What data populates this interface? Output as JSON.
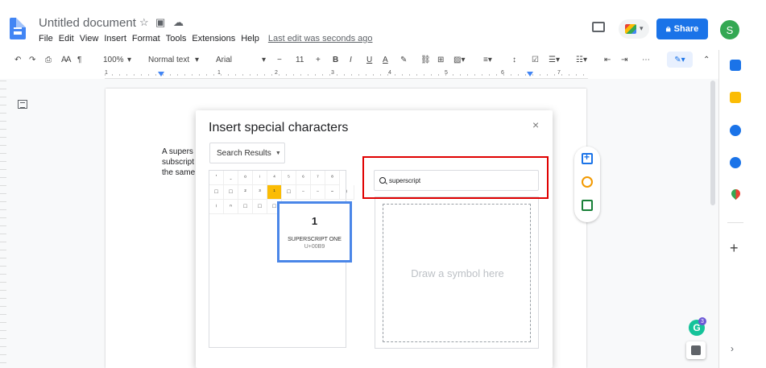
{
  "doc": {
    "title": "Untitled document",
    "last_edit": "Last edit was seconds ago"
  },
  "menu": [
    "File",
    "Edit",
    "View",
    "Insert",
    "Format",
    "Tools",
    "Extensions",
    "Help"
  ],
  "header": {
    "share_label": "Share",
    "avatar_letter": "S"
  },
  "toolbar": {
    "zoom": "100%",
    "style": "Normal text",
    "font": "Arial",
    "font_size": "11",
    "minus": "−",
    "plus": "+",
    "bold": "B",
    "italic": "I",
    "underline": "U",
    "text_color": "A"
  },
  "ruler": {
    "numbers": [
      "1",
      "1",
      "2",
      "3",
      "4",
      "5",
      "6",
      "7"
    ]
  },
  "page": {
    "text_lines": [
      "A supers",
      "subscript",
      "the same"
    ]
  },
  "dialog": {
    "title": "Insert special characters",
    "close": "×",
    "category": "Search Results",
    "search_value": "superscript",
    "draw_placeholder": "Draw a symbol here",
    "char_rows": [
      [
        "'",
        "ˍ",
        "⁰",
        "ⁱ",
        "⁴",
        "⁵",
        "⁶",
        "⁷",
        "⁸",
        "⁹"
      ],
      [
        "□",
        "□",
        "²",
        "³",
        "¹",
        "□",
        "⁻",
        "⁻",
        "⁼",
        "⁽"
      ],
      [
        "⁾",
        "ⁿ",
        "□",
        "□",
        "□",
        "",
        "",
        "",
        "",
        ""
      ]
    ],
    "preview": {
      "glyph": "1",
      "name": "SUPERSCRIPT ONE",
      "code": "U+00B9"
    }
  },
  "side": {
    "grammarly_letter": "G",
    "grammarly_count": "3"
  },
  "colors": {
    "accent": "#1a73e8",
    "highlight": "#e00000",
    "selected_char": "#fbbc04"
  }
}
